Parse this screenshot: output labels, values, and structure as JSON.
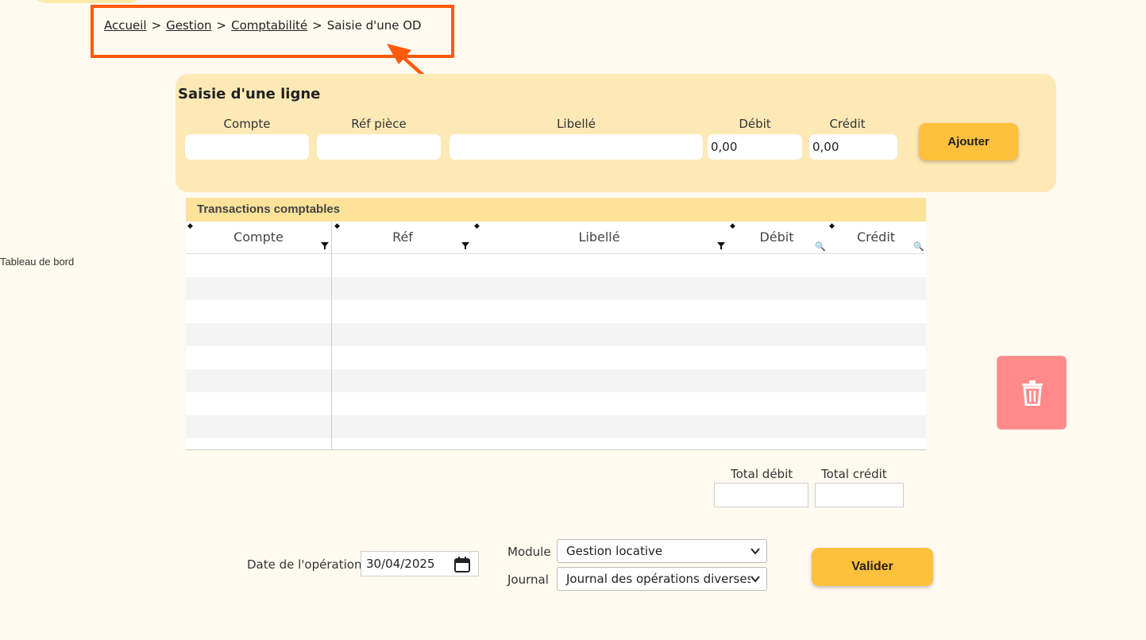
{
  "breadcrumb": {
    "items": [
      "Accueil",
      "Gestion",
      "Comptabilité"
    ],
    "current": "Saisie d'une OD",
    "separator": ">"
  },
  "sidenav": {
    "item": "Tableau de bord"
  },
  "entry": {
    "title": "Saisie d'une ligne",
    "labels": {
      "compte": "Compte",
      "ref": "Réf pièce",
      "libelle": "Libellé",
      "debit": "Débit",
      "credit": "Crédit"
    },
    "values": {
      "compte": "",
      "ref": "",
      "libelle": "",
      "debit": "0,00",
      "credit": "0,00"
    },
    "add_button": "Ajouter"
  },
  "grid": {
    "title": "Transactions comptables",
    "columns": [
      "Compte",
      "Réf",
      "Libellé",
      "Débit",
      "Crédit"
    ]
  },
  "totals": {
    "debit_label": "Total débit",
    "credit_label": "Total crédit",
    "debit_value": "",
    "credit_value": ""
  },
  "form": {
    "date_label": "Date de l'opération",
    "date_value": "30/04/2025",
    "module_label": "Module",
    "module_value": "Gestion locative",
    "journal_label": "Journal",
    "journal_value": "Journal des opérations diverses",
    "submit": "Valider"
  },
  "colors": {
    "accent": "#ffc03c",
    "panel": "#fde9b6",
    "highlight": "#ff5a0a",
    "delete": "#ff8a8a"
  }
}
